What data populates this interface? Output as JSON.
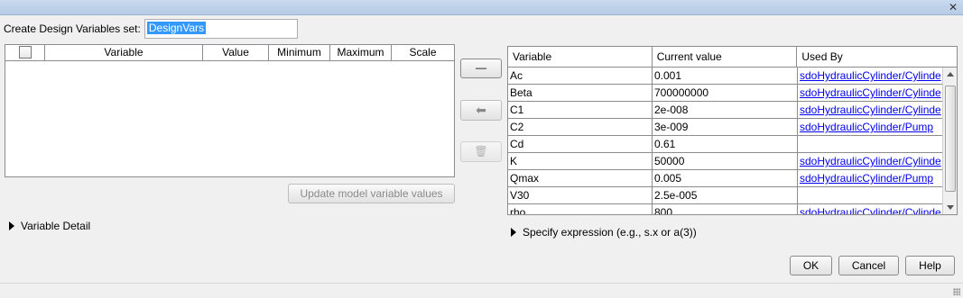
{
  "window": {
    "close_glyph": "✕"
  },
  "design_vars": {
    "label": "Create Design Variables set:",
    "value": "DesignVars"
  },
  "left_table": {
    "columns": [
      "Variable",
      "Value",
      "Minimum",
      "Maximum",
      "Scale"
    ]
  },
  "middle_buttons": {
    "remove_glyph": "—",
    "move_glyph": "⬅",
    "delete_glyph": "🗑"
  },
  "update_button": "Update model variable values",
  "variable_detail": "Variable Detail",
  "right_table": {
    "columns": [
      "Variable",
      "Current value",
      "Used By"
    ],
    "rows": [
      [
        "Ac",
        "0.001",
        "sdoHydraulicCylinder/Cylinde"
      ],
      [
        "Beta",
        "700000000",
        "sdoHydraulicCylinder/Cylinde"
      ],
      [
        "C1",
        "2e-008",
        "sdoHydraulicCylinder/Cylinde"
      ],
      [
        "C2",
        "3e-009",
        "sdoHydraulicCylinder/Pump"
      ],
      [
        "Cd",
        "0.61",
        ""
      ],
      [
        "K",
        "50000",
        "sdoHydraulicCylinder/Cylinde"
      ],
      [
        "Qmax",
        "0.005",
        "sdoHydraulicCylinder/Pump"
      ],
      [
        "V30",
        "2.5e-005",
        ""
      ],
      [
        "rho",
        "800",
        "sdoHydraulicCylinder/Cylinde"
      ]
    ]
  },
  "specify_expression": "Specify expression (e.g., s.x or a(3))",
  "footer": {
    "ok": "OK",
    "cancel": "Cancel",
    "help": "Help"
  }
}
